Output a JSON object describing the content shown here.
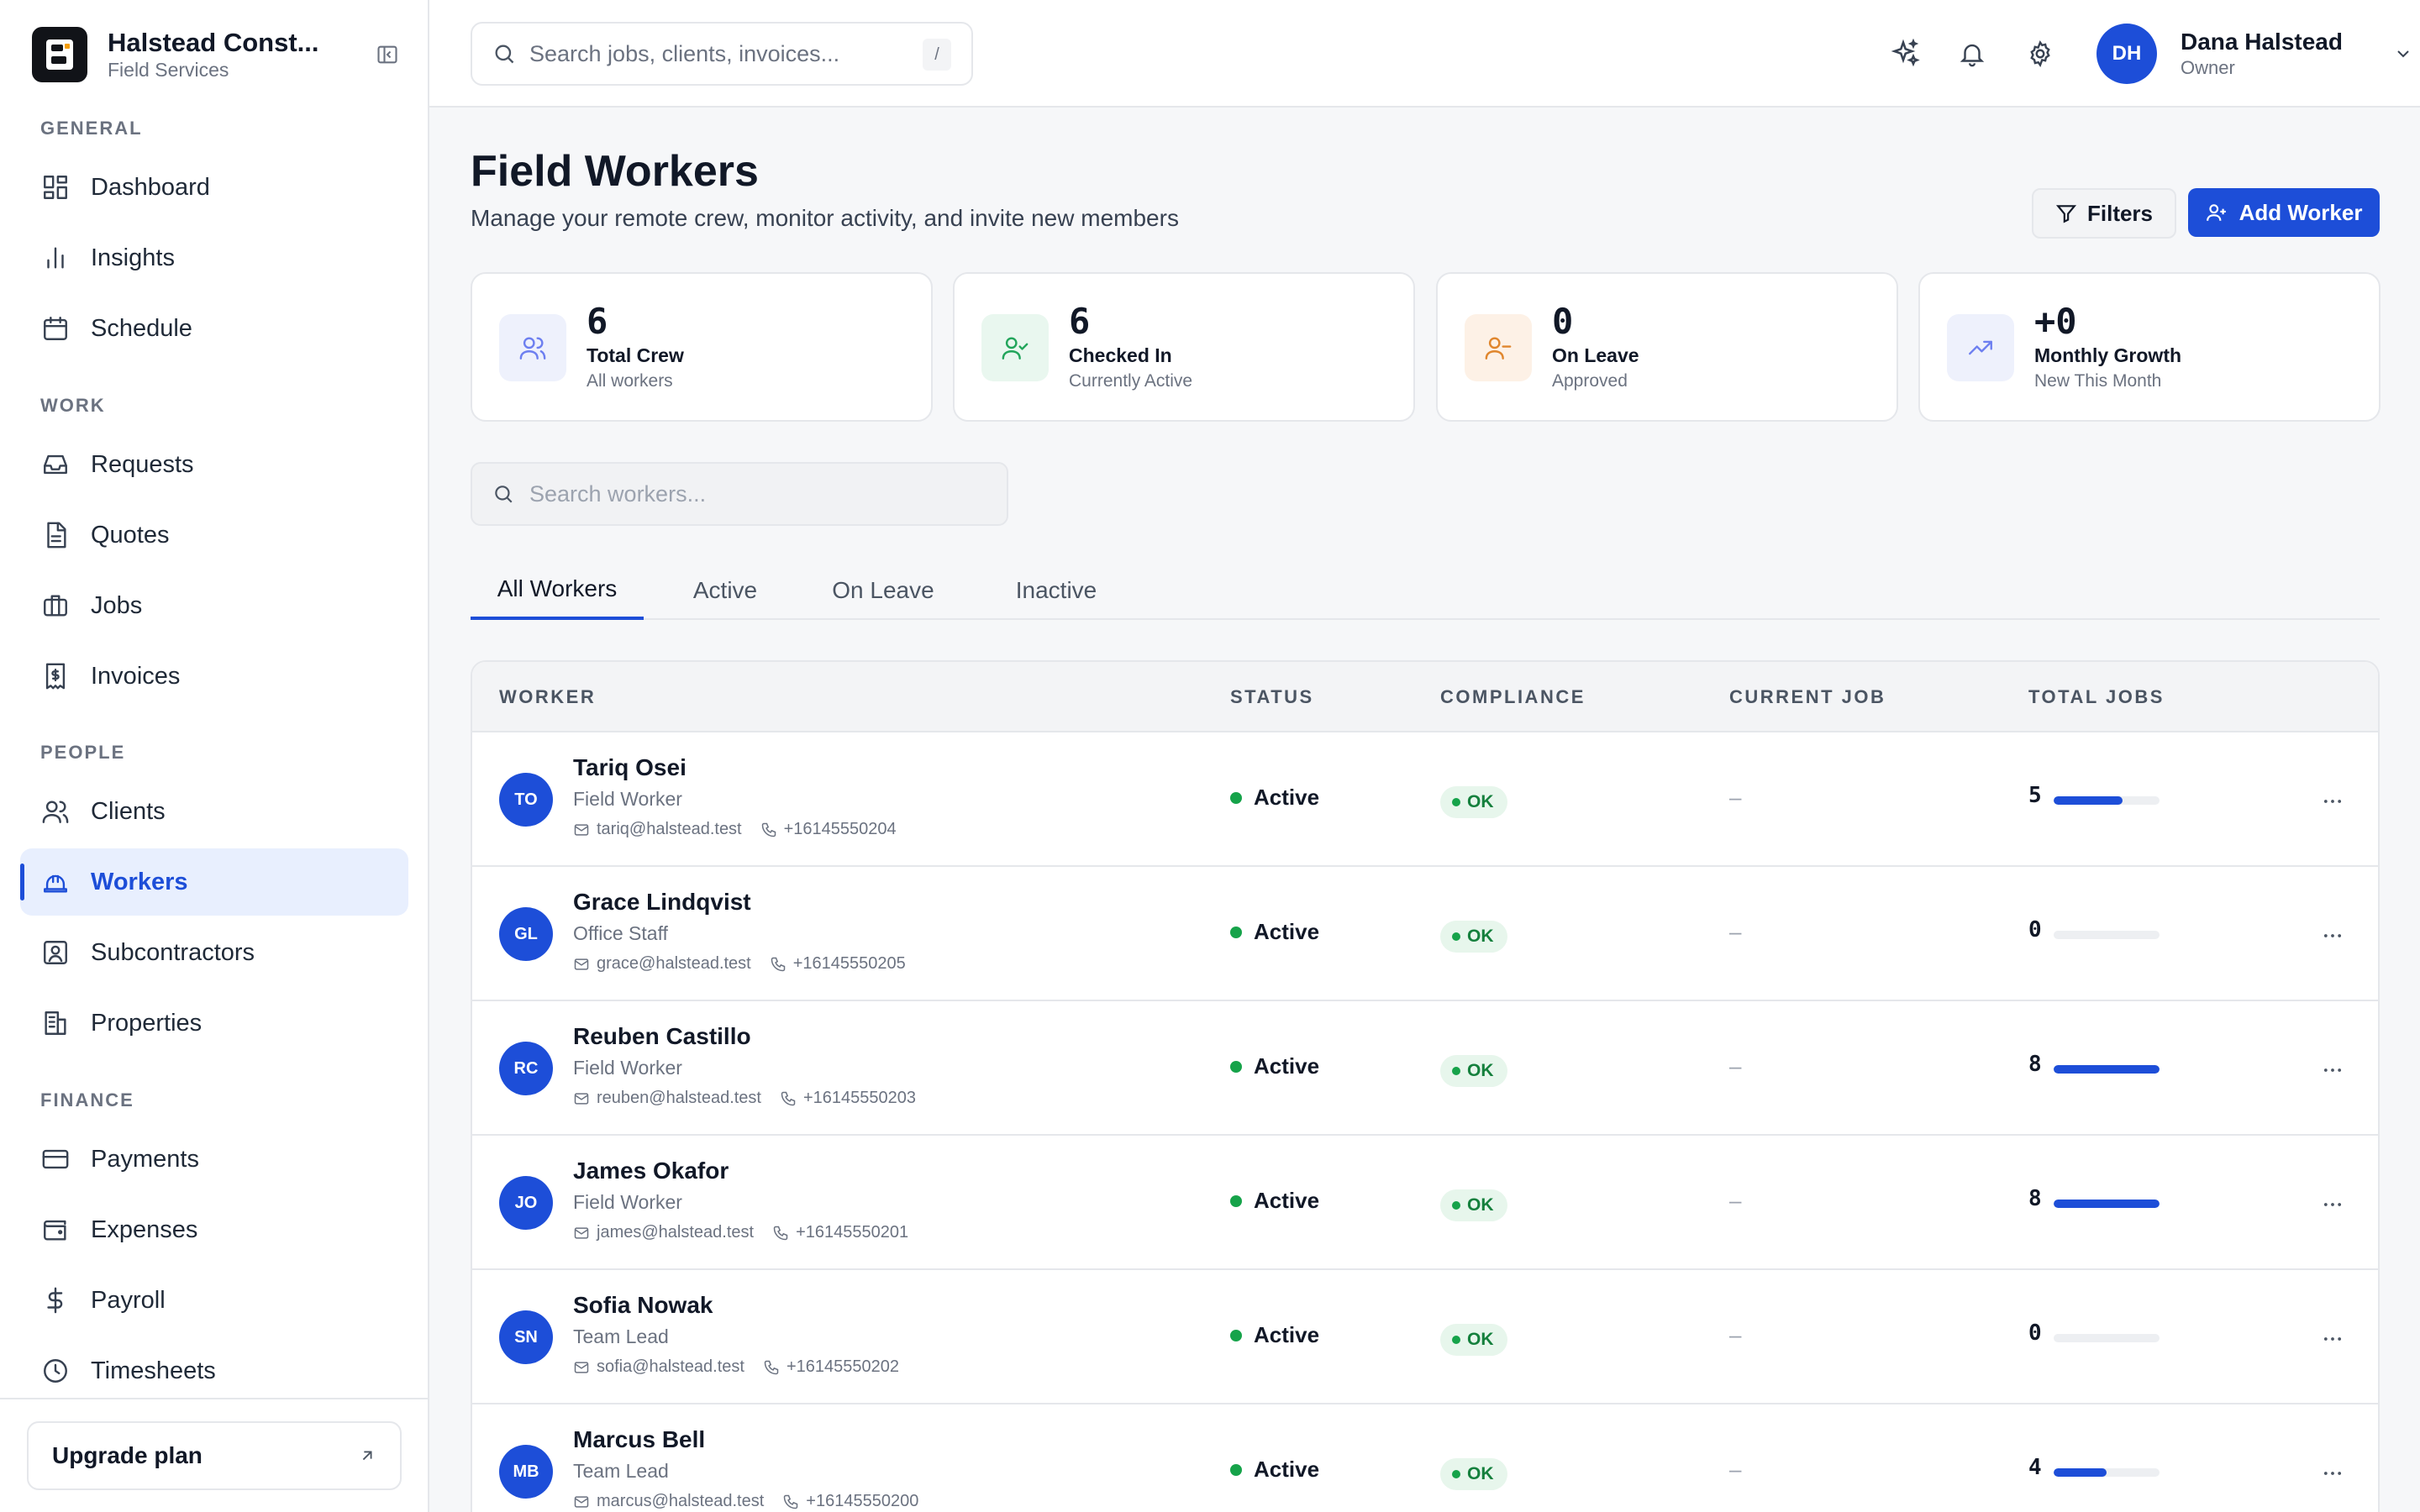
{
  "app": {
    "name": "Halstead Const...",
    "subtitle": "Field Services"
  },
  "sidebar": {
    "sections": [
      {
        "title": "GENERAL",
        "items": [
          {
            "label": "Dashboard",
            "icon": "dashboard-icon"
          },
          {
            "label": "Insights",
            "icon": "bar-chart-icon"
          },
          {
            "label": "Schedule",
            "icon": "calendar-icon"
          }
        ]
      },
      {
        "title": "WORK",
        "items": [
          {
            "label": "Requests",
            "icon": "inbox-icon"
          },
          {
            "label": "Quotes",
            "icon": "document-icon"
          },
          {
            "label": "Jobs",
            "icon": "briefcase-icon"
          },
          {
            "label": "Invoices",
            "icon": "invoice-icon"
          }
        ]
      },
      {
        "title": "PEOPLE",
        "items": [
          {
            "label": "Clients",
            "icon": "users-icon"
          },
          {
            "label": "Workers",
            "icon": "hard-hat-icon",
            "active": true
          },
          {
            "label": "Subcontractors",
            "icon": "contact-icon"
          },
          {
            "label": "Properties",
            "icon": "building-icon"
          }
        ]
      },
      {
        "title": "FINANCE",
        "items": [
          {
            "label": "Payments",
            "icon": "credit-card-icon"
          },
          {
            "label": "Expenses",
            "icon": "wallet-icon"
          },
          {
            "label": "Payroll",
            "icon": "dollar-icon"
          },
          {
            "label": "Timesheets",
            "icon": "clock-icon"
          }
        ]
      }
    ],
    "upgrade_label": "Upgrade plan"
  },
  "topbar": {
    "search_placeholder": "Search jobs, clients, invoices...",
    "search_shortcut": "/",
    "user": {
      "initials": "DH",
      "name": "Dana Halstead",
      "role": "Owner"
    }
  },
  "page": {
    "title": "Field Workers",
    "subtitle": "Manage your remote crew, monitor activity, and invite new members",
    "filters_label": "Filters",
    "add_label": "Add Worker"
  },
  "stats": [
    {
      "value": "6",
      "label": "Total Crew",
      "sub": "All workers",
      "icon": "users-icon",
      "color": "#6d7ff0",
      "bg": "#eef1fc"
    },
    {
      "value": "6",
      "label": "Checked In",
      "sub": "Currently Active",
      "icon": "user-check-icon",
      "color": "#22a55b",
      "bg": "#e9f7ef"
    },
    {
      "value": "0",
      "label": "On Leave",
      "sub": "Approved",
      "icon": "user-minus-icon",
      "color": "#e0862d",
      "bg": "#fdf1e6"
    },
    {
      "value": "+0",
      "label": "Monthly Growth",
      "sub": "New This Month",
      "icon": "trending-up-icon",
      "color": "#6d7ff0",
      "bg": "#eef1fc"
    }
  ],
  "worker_search_placeholder": "Search workers...",
  "tabs": [
    "All Workers",
    "Active",
    "On Leave",
    "Inactive"
  ],
  "active_tab": "All Workers",
  "table": {
    "columns": [
      "WORKER",
      "STATUS",
      "COMPLIANCE",
      "CURRENT JOB",
      "TOTAL JOBS"
    ],
    "rows": [
      {
        "initials": "TO",
        "name": "Tariq Osei",
        "role": "Field Worker",
        "email": "tariq@halstead.test",
        "phone": "+16145550204",
        "status": "Active",
        "compliance": "OK",
        "current_job": "–",
        "total_jobs": "5",
        "progress": 0.65
      },
      {
        "initials": "GL",
        "name": "Grace Lindqvist",
        "role": "Office Staff",
        "email": "grace@halstead.test",
        "phone": "+16145550205",
        "status": "Active",
        "compliance": "OK",
        "current_job": "–",
        "total_jobs": "0",
        "progress": 0
      },
      {
        "initials": "RC",
        "name": "Reuben Castillo",
        "role": "Field Worker",
        "email": "reuben@halstead.test",
        "phone": "+16145550203",
        "status": "Active",
        "compliance": "OK",
        "current_job": "–",
        "total_jobs": "8",
        "progress": 1.0
      },
      {
        "initials": "JO",
        "name": "James Okafor",
        "role": "Field Worker",
        "email": "james@halstead.test",
        "phone": "+16145550201",
        "status": "Active",
        "compliance": "OK",
        "current_job": "–",
        "total_jobs": "8",
        "progress": 1.0
      },
      {
        "initials": "SN",
        "name": "Sofia Nowak",
        "role": "Team Lead",
        "email": "sofia@halstead.test",
        "phone": "+16145550202",
        "status": "Active",
        "compliance": "OK",
        "current_job": "–",
        "total_jobs": "0",
        "progress": 0
      },
      {
        "initials": "MB",
        "name": "Marcus Bell",
        "role": "Team Lead",
        "email": "marcus@halstead.test",
        "phone": "+16145550200",
        "status": "Active",
        "compliance": "OK",
        "current_job": "–",
        "total_jobs": "4",
        "progress": 0.5
      }
    ]
  },
  "colors": {
    "accent": "#1d4ed8",
    "status_active": "#16a34a",
    "compliance_ok_bg": "#e7f6ec",
    "compliance_ok_text": "#15803d"
  }
}
